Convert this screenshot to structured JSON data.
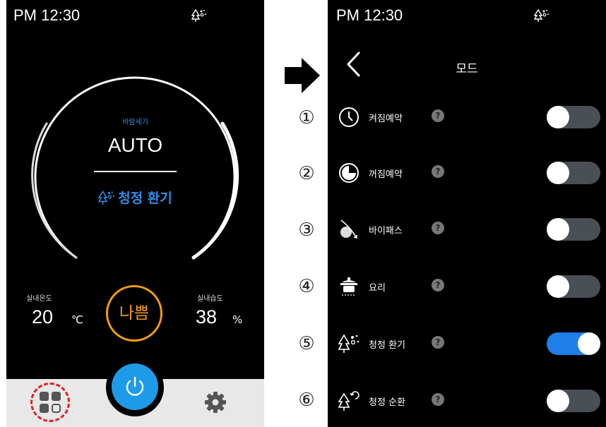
{
  "left_screen": {
    "time": "PM 12:30",
    "fan_label": "바람세기",
    "fan_mode": "AUTO",
    "current_mode": "청정 환기",
    "indoor_temp_label": "실내온도",
    "indoor_temp_value": "20",
    "indoor_temp_unit": "℃",
    "indoor_humidity_label": "실내습도",
    "indoor_humidity_value": "38",
    "indoor_humidity_unit": "%",
    "air_quality": "나쁨"
  },
  "colors": {
    "accent_blue": "#1e9be8",
    "air_quality_orange": "#f39c12",
    "highlight_red": "#e02020",
    "toggle_on": "#1e7fe8",
    "toggle_off": "#4a4e55"
  },
  "right_screen": {
    "time": "PM 12:30",
    "title": "모드",
    "modes": [
      {
        "number": "①",
        "label": "켜짐예약",
        "icon": "clock-icon",
        "help": "?",
        "enabled": false
      },
      {
        "number": "②",
        "label": "꺼짐예약",
        "icon": "clock-off-icon",
        "help": "?",
        "enabled": false
      },
      {
        "number": "③",
        "label": "바이패스",
        "icon": "bypass-icon",
        "help": "?",
        "enabled": false
      },
      {
        "number": "④",
        "label": "요리",
        "icon": "pot-icon",
        "help": "?",
        "enabled": false
      },
      {
        "number": "⑤",
        "label": "청정 환기",
        "icon": "clean-ventilation-icon",
        "help": "?",
        "enabled": true
      },
      {
        "number": "⑥",
        "label": "청정 순환",
        "icon": "clean-circulation-icon",
        "help": "?",
        "enabled": false
      }
    ]
  }
}
